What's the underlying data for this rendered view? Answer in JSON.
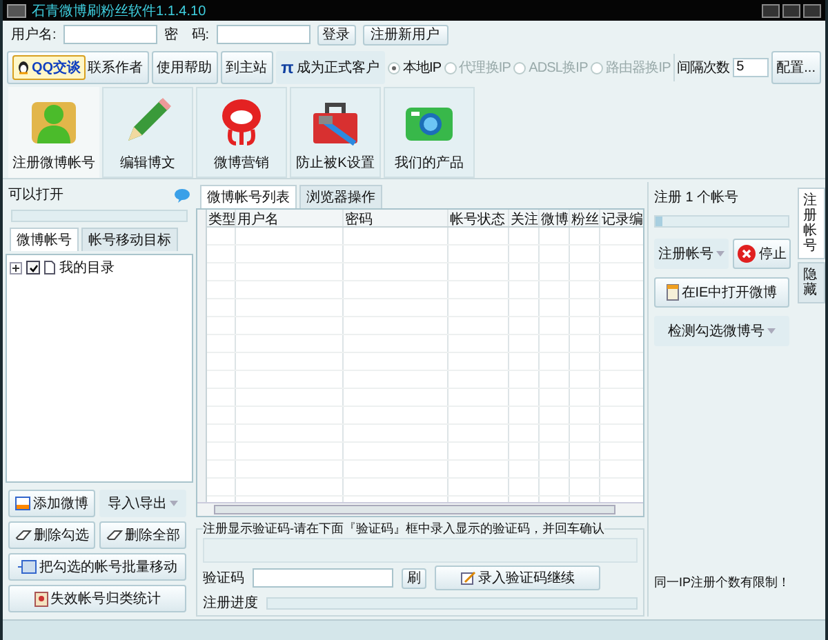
{
  "window": {
    "title": "石青微博刷粉丝软件1.1.4.10"
  },
  "login": {
    "user_label": "用户名:",
    "password_label": "密　码:",
    "login_button": "登录",
    "register_button": "注册新用户"
  },
  "toolbar": {
    "qq_button": "QQ交谈",
    "contact": "联系作者",
    "help": "使用帮助",
    "home": "到主站",
    "pi": "π",
    "customer": "成为正式客户",
    "ip_options": [
      {
        "label": "本地IP",
        "selected": true,
        "disabled": false
      },
      {
        "label": "代理换IP",
        "selected": false,
        "disabled": true
      },
      {
        "label": "ADSL换IP",
        "selected": false,
        "disabled": true
      },
      {
        "label": "路由器换IP",
        "selected": false,
        "disabled": true
      }
    ],
    "interval_label": "间隔次数",
    "interval_value": "5",
    "config_button": "配置..."
  },
  "tiles": [
    {
      "kind": "person",
      "label": "注册微博帐号",
      "selected": true
    },
    {
      "kind": "pencil",
      "label": "编辑博文",
      "selected": false
    },
    {
      "kind": "weibo",
      "label": "微博营销",
      "selected": false
    },
    {
      "kind": "toolbox",
      "label": "防止被K设置",
      "selected": false
    },
    {
      "kind": "camera",
      "label": "我们的产品",
      "selected": false
    }
  ],
  "left": {
    "title": "可以打开",
    "tabs": [
      {
        "label": "微博帐号",
        "selected": true
      },
      {
        "label": "帐号移动目标",
        "selected": false
      }
    ],
    "tree": [
      {
        "label": "我的目录",
        "checked": true,
        "expanded": false
      }
    ],
    "buttons": [
      {
        "kind": "add",
        "label": "添加微博"
      },
      {
        "kind": "dropdown",
        "label": "导入\\导出"
      },
      {
        "kind": "erase",
        "label": "删除勾选"
      },
      {
        "kind": "erase",
        "label": "删除全部"
      },
      {
        "kind": "move",
        "label": "把勾选的帐号批量移动"
      },
      {
        "kind": "stats",
        "label": "失效帐号归类统计"
      }
    ]
  },
  "center": {
    "tabs": [
      {
        "label": "微博帐号列表",
        "selected": true
      },
      {
        "label": "浏览器操作",
        "selected": false
      }
    ],
    "table": {
      "columns": [
        "类型",
        "用户名",
        "密码",
        "帐号状态",
        "关注",
        "微博",
        "粉丝",
        "记录编"
      ]
    },
    "captcha": {
      "legend": "注册显示验证码-请在下面『验证码』框中录入显示的验证码，并回车确认",
      "code_label": "验证码",
      "refresh_button": "刷",
      "submit_button": "录入验证码继续",
      "progress_label": "注册进度",
      "progress": {
        "level": 0
      }
    }
  },
  "right": {
    "count_text": "注册 1 个帐号",
    "progress": {
      "level": 0.05
    },
    "register_button": "注册帐号",
    "stop_button": "停止",
    "ie_button": "在IE中打开微博",
    "check_button": "检测勾选微博号",
    "note": "同一IP注册个数有限制！"
  },
  "side_tabs": [
    {
      "label": "注册帐号",
      "selected": true
    },
    {
      "label": "隐藏",
      "selected": false
    }
  ]
}
